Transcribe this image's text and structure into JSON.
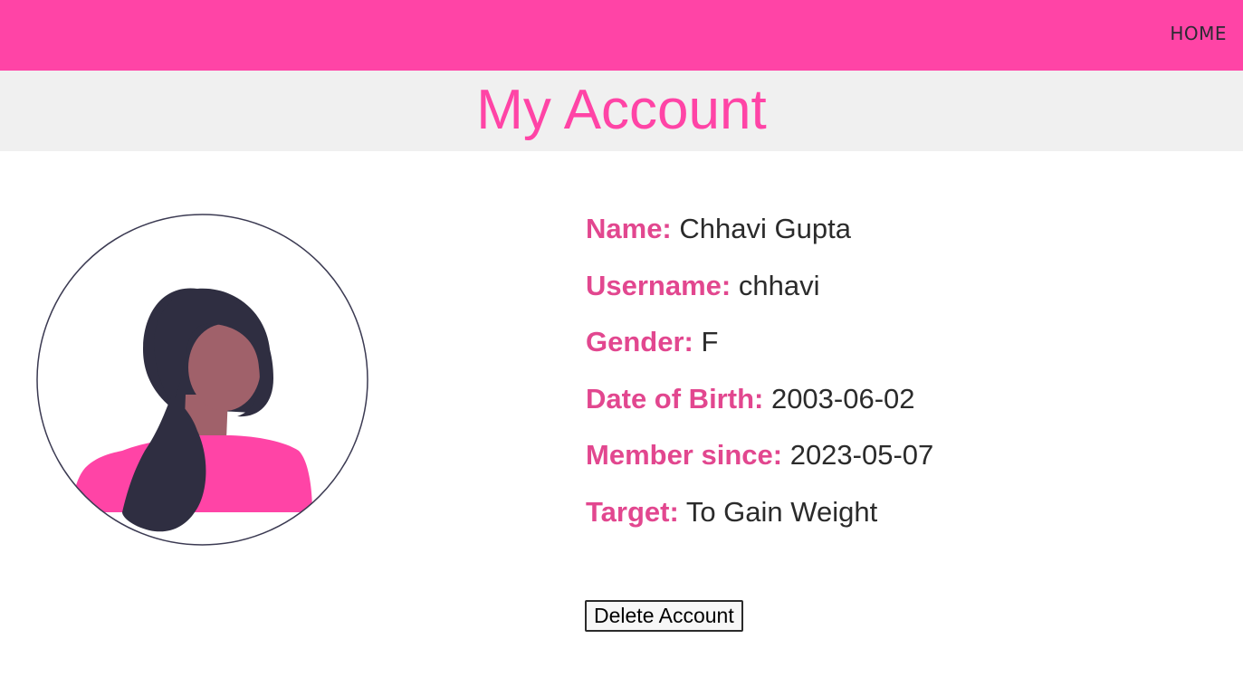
{
  "nav": {
    "home_label": "HOME"
  },
  "page": {
    "title": "My Account"
  },
  "profile": {
    "name_label": "Name:",
    "name_value": "Chhavi Gupta",
    "username_label": "Username:",
    "username_value": "chhavi",
    "gender_label": "Gender:",
    "gender_value": "F",
    "dob_label": "Date of Birth:",
    "dob_value": "2003-06-02",
    "member_label": "Member since:",
    "member_value": "2023-05-07",
    "target_label": "Target:",
    "target_value": "To Gain Weight"
  },
  "actions": {
    "delete_label": "Delete Account"
  },
  "colors": {
    "accent": "#ff44a6",
    "label": "#e2478f",
    "band": "#f0f0f0",
    "hair": "#2f2e41",
    "skin": "#a0616a"
  },
  "icons": {
    "avatar": "woman-avatar-icon"
  }
}
